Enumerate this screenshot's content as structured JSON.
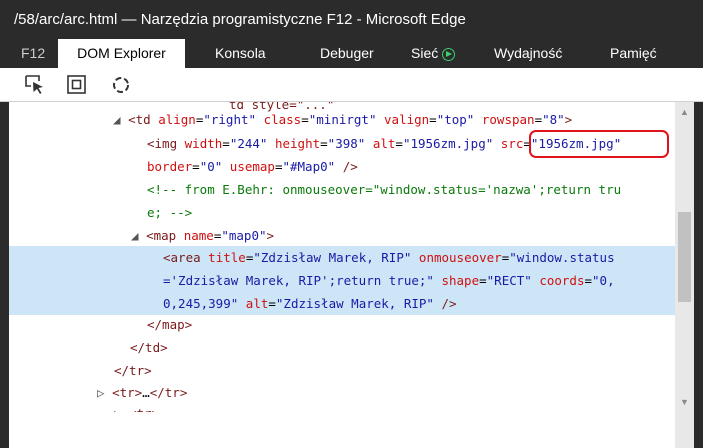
{
  "window": {
    "title": "/58/arc/arc.html — Narzędzia programistyczne F12 - Microsoft Edge"
  },
  "tabs": [
    {
      "label": "F12"
    },
    {
      "label": "DOM Explorer"
    },
    {
      "label": "Konsola"
    },
    {
      "label": "Debuger"
    },
    {
      "label": "Sieć"
    },
    {
      "label": "Wydajność"
    },
    {
      "label": "Pamięć"
    }
  ],
  "toolbar": {
    "icons": [
      "select-element-icon",
      "highlight-box-icon",
      "refresh-icon"
    ]
  },
  "dom": {
    "l0": {
      "tail": "td style=\"...\""
    },
    "l1": {
      "tag": "td",
      "a1": "align",
      "v1": "\"right\"",
      "a2": "class",
      "v2": "\"minirgt\"",
      "a3": "valign",
      "v3": "\"top\"",
      "a4": "rowspan",
      "v4": "\"8\""
    },
    "l2": {
      "tag": "img",
      "a1": "width",
      "v1": "\"244\"",
      "a2": "height",
      "v2": "\"398\"",
      "a3": "alt",
      "v3": "\"1956zm.jpg\"",
      "a4": "src",
      "v4": "\"1956zm.jpg\""
    },
    "l3": {
      "a1": "border",
      "v1": "\"0\"",
      "a2": "usemap",
      "v2": "\"#Map0\""
    },
    "l4": {
      "comment": "<!-- from E.Behr: onmouseover=\"window.status='nazwa';return tru"
    },
    "l5": {
      "comment": "e; -->"
    },
    "l6": {
      "tag": "map",
      "a1": "name",
      "v1": "\"map0\""
    },
    "l7": {
      "tag": "area",
      "a1": "title",
      "v1": "\"Zdzisław Marek, RIP\"",
      "a2": "onmouseover",
      "v2": "\"window.status"
    },
    "l8": {
      "v2b": "='Zdzisław Marek, RIP';return true;\"",
      "a3": "shape",
      "v3": "\"RECT\"",
      "a4": "coords",
      "v4": "\"0,"
    },
    "l9": {
      "v4b": "0,245,399\"",
      "a5": "alt",
      "v5": "\"Zdzisław Marek, RIP\""
    },
    "l10": {
      "tag": "/map"
    },
    "l11": {
      "tag": "/td"
    },
    "l12": {
      "tag": "/tr"
    },
    "l13": {
      "tag": "tr",
      "ellipsis": "…",
      "close": "/tr"
    }
  }
}
